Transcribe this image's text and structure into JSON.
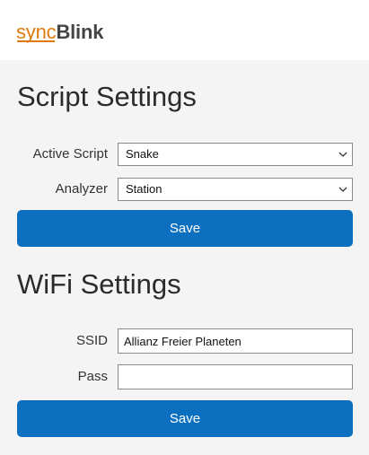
{
  "logo": {
    "part1": "sync",
    "part2": "Blink"
  },
  "script_settings": {
    "title": "Script Settings",
    "active_script_label": "Active Script",
    "active_script_value": "Snake",
    "analyzer_label": "Analyzer",
    "analyzer_value": "Station",
    "save_label": "Save"
  },
  "wifi_settings": {
    "title": "WiFi Settings",
    "ssid_label": "SSID",
    "ssid_value": "Allianz Freier Planeten",
    "pass_label": "Pass",
    "pass_value": "",
    "save_label": "Save"
  },
  "icons": {
    "dropdown": "chevron-down-icon"
  },
  "colors": {
    "accent": "#0d6fc0",
    "logo_orange": "#e07a10",
    "logo_gray": "#444444",
    "background": "#f4f4f4"
  }
}
